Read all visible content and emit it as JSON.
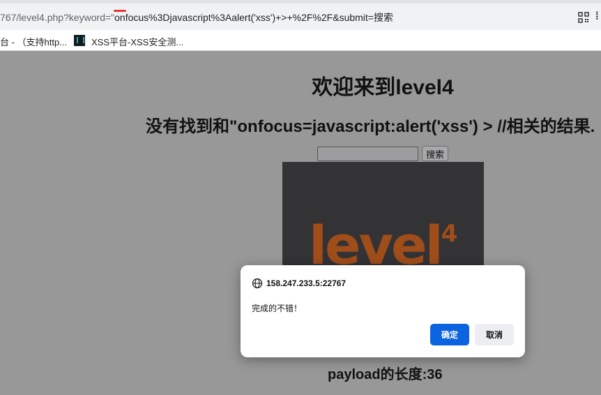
{
  "browser": {
    "url_prefix": "767/level4.php?keyword=\"",
    "url_highlight": "onfocus%3Djavascript%3Aalert('xss')+>+%2F%2F&submit=搜索",
    "bookmarks": [
      {
        "label": "台 - （支持http..."
      },
      {
        "label": "XSS平台-XSS安全测..."
      }
    ]
  },
  "page": {
    "heading": "欢迎来到level4",
    "result": "没有找到和\"onfocus=javascript:alert('xss') > //相关的结果.",
    "search_value": "",
    "search_button": "搜索",
    "image_logo": "level",
    "image_logo_sup": "4",
    "payload_length": "payload的长度:36"
  },
  "dialog": {
    "origin": "158.247.233.5:22767",
    "message": "完成的不错！",
    "ok_label": "确定",
    "cancel_label": "取消"
  },
  "colors": {
    "overlay": "#989899",
    "accent": "#0b63e0",
    "logo": "#a04d1a"
  }
}
